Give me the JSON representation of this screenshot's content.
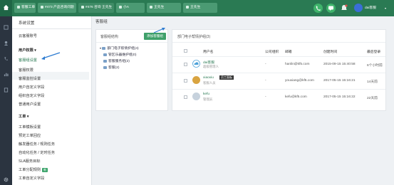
{
  "topbar": {
    "tabs": [
      {
        "label": "客服工单"
      },
      {
        "label": "#473 产品咨询问题"
      },
      {
        "label": "#476 咨询 王先生"
      },
      {
        "label": "小A"
      },
      {
        "label": "王先生"
      },
      {
        "label": "王先生"
      }
    ],
    "user": {
      "name": "dai客服"
    },
    "colors": {
      "brand": "#2a7a53",
      "phone": "#3fb36b",
      "chat": "#3fb36b",
      "notify": "#d9534f"
    }
  },
  "sidebar": {
    "title": "系统设置",
    "items": [
      {
        "label": "云客服账号"
      },
      {
        "label": "用户权限"
      },
      {
        "label": "客服组设置"
      },
      {
        "label": "客服权限"
      },
      {
        "label": "客服监控设置"
      },
      {
        "label": "用户自定义字段"
      },
      {
        "label": "组织自定义字段"
      },
      {
        "label": "普通用户设置"
      },
      {
        "label": "工单"
      },
      {
        "label": "工单模板设置"
      },
      {
        "label": "预定工单回应"
      },
      {
        "label": "触发器任务 / 规则任务"
      },
      {
        "label": "自动化任务 / 定时任务"
      },
      {
        "label": "SLA服务目标"
      },
      {
        "label": "工单分配规则"
      },
      {
        "label": "工单自定义字段"
      }
    ],
    "new_badge": "新"
  },
  "content": {
    "title": "客服组",
    "group_panel": {
      "title": "客服组结构",
      "add_button": "添加客服组",
      "groups": [
        {
          "label": "部门电子帮情护组(4)"
        },
        {
          "label": "管区乐器维护组(0)"
        },
        {
          "label": "客服服务组(2)"
        },
        {
          "label": "客服(2)"
        }
      ]
    },
    "member_panel": {
      "title": "部门电子帮情护组(3)",
      "columns": [
        "用户名",
        "公司组织",
        "邮箱",
        "创建时间",
        "最后登录"
      ],
      "rows": [
        {
          "name": "dai客服",
          "role": "超级管理人",
          "org": "-",
          "email": "hanlin@kf5.com",
          "created": "2015-09-15 15:40:58",
          "last": "6个小时前"
        },
        {
          "name": "xiaoxiu",
          "role": "客服人员",
          "tag": "员工面板",
          "org": "-",
          "email": "youxiang@kf5.com",
          "created": "2017-05-15 15:16:21",
          "last": "14天前"
        },
        {
          "name": "kefu",
          "role": "管理员",
          "org": "-",
          "email": "kefu@kf5.com",
          "created": "2017-05-15 15:16:22",
          "last": "22天前"
        }
      ]
    }
  },
  "icons": [
    "home-icon",
    "user-icon",
    "phone-icon",
    "chat-icon",
    "bell-icon",
    "gear-icon",
    "cloud-icon",
    "folder-icon"
  ]
}
